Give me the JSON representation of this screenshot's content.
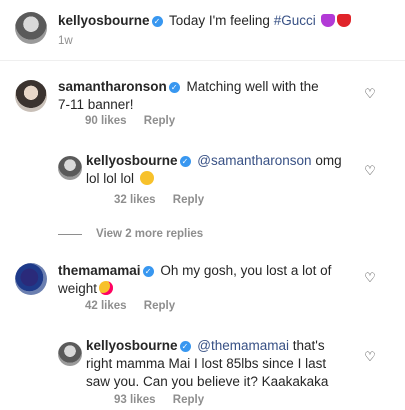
{
  "caption": {
    "username": "kellyosbourne",
    "text": "Today I'm feeling ",
    "hashtag": "#Gucci",
    "time": "1w"
  },
  "comments": [
    {
      "username": "samantharonson",
      "text": "Matching well with the",
      "text2": "7-11 banner!",
      "likes": "90 likes",
      "reply": "Reply",
      "replies": [
        {
          "username": "kellyosbourne",
          "mention": "@samantharonson",
          "text": " omg",
          "text2": "lol lol lol",
          "likes": "32 likes",
          "reply": "Reply"
        }
      ]
    },
    {
      "view_more": "View 2 more replies"
    },
    {
      "username": "themamamai",
      "text": "Oh my gosh,  you lost  a lot of",
      "text2": "weight",
      "likes": "42 likes",
      "reply": "Reply",
      "replies": [
        {
          "username": "kellyosbourne",
          "mention": "@themamamai",
          "text": " that's",
          "text2": "right mamma Mai I lost 85lbs since I last",
          "text3": "saw you. Can you believe it? Kaakakaka",
          "likes": "93 likes",
          "reply": "Reply"
        }
      ]
    }
  ],
  "icons": {
    "verified": "verified-badge",
    "like": "heart-outline-icon"
  },
  "colors": {
    "link": "#385185",
    "verified": "#3897f0",
    "muted": "#8e8e8e"
  }
}
